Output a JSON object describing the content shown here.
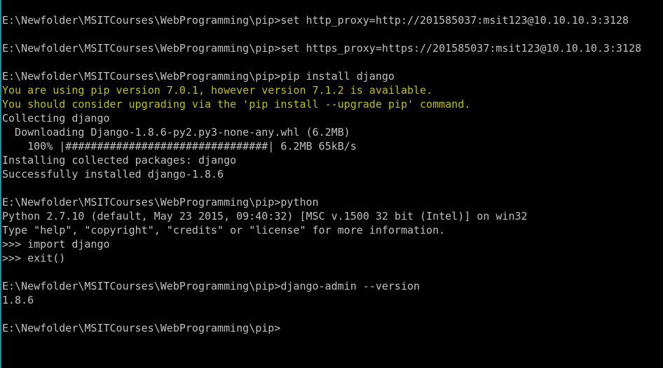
{
  "colors": {
    "background": "#000000",
    "text": "#c0c0c0",
    "warning": "#c0c000"
  },
  "console": {
    "lines": [
      {
        "text": "E:\\Newfolder\\MSITCourses\\WebProgramming\\pip>set http_proxy=http://201585037:msit123@10.10.10.3:3128",
        "kind": "normal"
      },
      {
        "text": "",
        "kind": "normal"
      },
      {
        "text": "E:\\Newfolder\\MSITCourses\\WebProgramming\\pip>set https_proxy=https://201585037:msit123@10.10.10.3:3128",
        "kind": "normal"
      },
      {
        "text": "",
        "kind": "normal"
      },
      {
        "text": "E:\\Newfolder\\MSITCourses\\WebProgramming\\pip>pip install django",
        "kind": "normal"
      },
      {
        "text": "You are using pip version 7.0.1, however version 7.1.2 is available.",
        "kind": "warn"
      },
      {
        "text": "You should consider upgrading via the 'pip install --upgrade pip' command.",
        "kind": "warn"
      },
      {
        "text": "Collecting django",
        "kind": "normal"
      },
      {
        "text": "  Downloading Django-1.8.6-py2.py3-none-any.whl (6.2MB)",
        "kind": "normal"
      },
      {
        "text": "    100% |################################| 6.2MB 65kB/s",
        "kind": "normal"
      },
      {
        "text": "Installing collected packages: django",
        "kind": "normal"
      },
      {
        "text": "Successfully installed django-1.8.6",
        "kind": "normal"
      },
      {
        "text": "",
        "kind": "normal"
      },
      {
        "text": "E:\\Newfolder\\MSITCourses\\WebProgramming\\pip>python",
        "kind": "normal"
      },
      {
        "text": "Python 2.7.10 (default, May 23 2015, 09:40:32) [MSC v.1500 32 bit (Intel)] on win32",
        "kind": "normal"
      },
      {
        "text": "Type \"help\", \"copyright\", \"credits\" or \"license\" for more information.",
        "kind": "normal"
      },
      {
        "text": ">>> import django",
        "kind": "normal"
      },
      {
        "text": ">>> exit()",
        "kind": "normal"
      },
      {
        "text": "",
        "kind": "normal"
      },
      {
        "text": "E:\\Newfolder\\MSITCourses\\WebProgramming\\pip>django-admin --version",
        "kind": "normal"
      },
      {
        "text": "1.8.6",
        "kind": "normal"
      },
      {
        "text": "",
        "kind": "normal"
      },
      {
        "text": "E:\\Newfolder\\MSITCourses\\WebProgramming\\pip>",
        "kind": "normal"
      }
    ]
  }
}
